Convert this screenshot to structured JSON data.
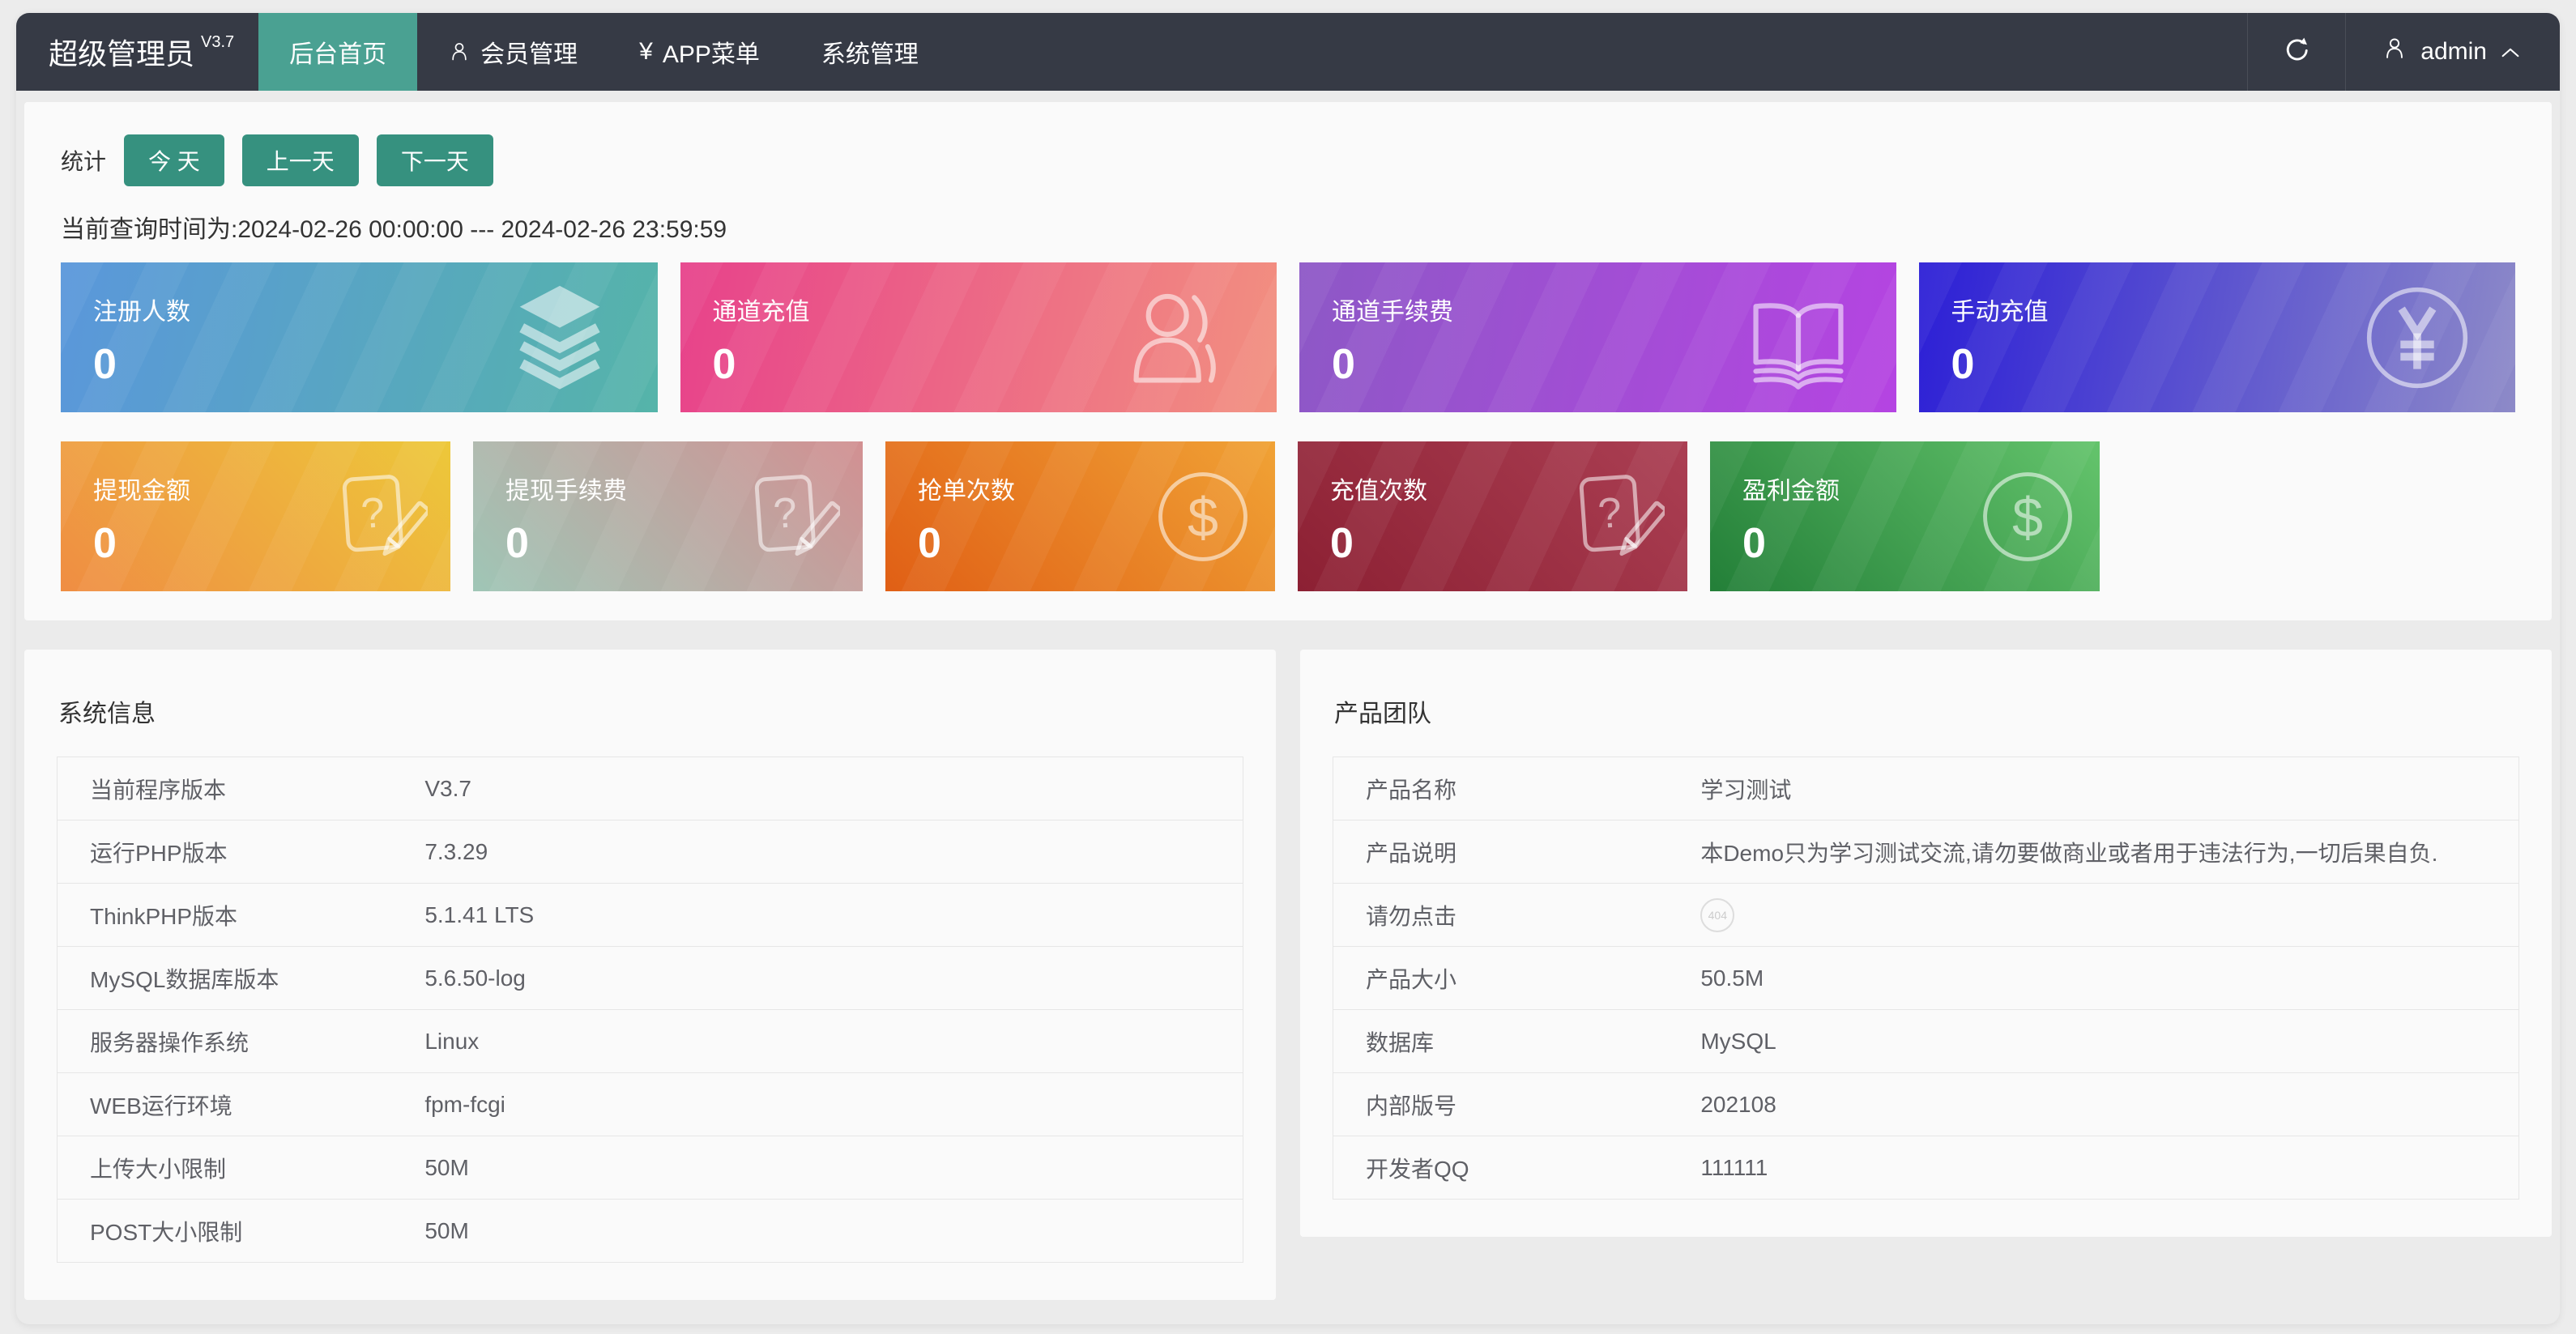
{
  "colors": {
    "navbar_bg": "#363a45",
    "tab_active": "#4aa192",
    "accent_teal": "#36917f",
    "panel_bg": "#fafafa",
    "page_bg": "#ececec"
  },
  "navbar": {
    "brand": "超级管理员",
    "brand_version": "V3.7",
    "tabs": [
      {
        "id": "home",
        "label": "后台首页",
        "active": true
      },
      {
        "id": "members",
        "label": "会员管理",
        "icon": "user-icon"
      },
      {
        "id": "app-menu",
        "label": "APP菜单",
        "icon": "yen-icon"
      },
      {
        "id": "system",
        "label": "系统管理"
      }
    ],
    "refresh_icon": "refresh-icon",
    "username": "admin"
  },
  "stats": {
    "section_label": "统计",
    "buttons": [
      {
        "id": "today",
        "label": "今 天"
      },
      {
        "id": "prev-day",
        "label": "上一天"
      },
      {
        "id": "next-day",
        "label": "下一天"
      }
    ],
    "query_time": "当前查询时间为:2024-02-26 00:00:00 --- 2024-02-26 23:59:59",
    "cards_row1": [
      {
        "id": "registered-users",
        "title": "注册人数",
        "value": "0",
        "icon": "layers-icon",
        "c1": "#5a97db",
        "c2": "#55b4a9"
      },
      {
        "id": "channel-recharge",
        "title": "通道充值",
        "value": "0",
        "icon": "user-outline-icon",
        "c1": "#e7428b",
        "c2": "#f29080"
      },
      {
        "id": "channel-fee",
        "title": "通道手续费",
        "value": "0",
        "icon": "book-icon",
        "c1": "#8d58c6",
        "c2": "#b544e2"
      },
      {
        "id": "manual-recharge",
        "title": "手动充值",
        "value": "0",
        "icon": "yen-circle-icon",
        "c1": "#2c1fd6",
        "c2": "#8d8ac8"
      }
    ],
    "cards_row2": [
      {
        "id": "withdraw-amount",
        "title": "提现金额",
        "value": "0",
        "icon": "question-doc-icon",
        "c1": "#ef8d43",
        "c2": "#edc83a"
      },
      {
        "id": "withdraw-fee",
        "title": "提现手续费",
        "value": "0",
        "icon": "question-doc-icon",
        "c1": "#9fc6b6",
        "c2": "#d29092"
      },
      {
        "id": "grab-count",
        "title": "抢单次数",
        "value": "0",
        "icon": "dollar-circle-icon",
        "c1": "#e05f15",
        "c2": "#f0a235"
      },
      {
        "id": "recharge-count",
        "title": "充值次数",
        "value": "0",
        "icon": "question-doc-icon",
        "c1": "#8c2033",
        "c2": "#ab3f53"
      },
      {
        "id": "profit-amount",
        "title": "盈利金额",
        "value": "0",
        "icon": "dollar-circle-icon",
        "c1": "#237f38",
        "c2": "#64c46c"
      }
    ]
  },
  "system_panel": {
    "title": "系统信息",
    "rows": [
      {
        "label": "当前程序版本",
        "value": "V3.7"
      },
      {
        "label": "运行PHP版本",
        "value": "7.3.29"
      },
      {
        "label": "ThinkPHP版本",
        "value": "5.1.41 LTS"
      },
      {
        "label": "MySQL数据库版本",
        "value": "5.6.50-log"
      },
      {
        "label": "服务器操作系统",
        "value": "Linux"
      },
      {
        "label": "WEB运行环境",
        "value": "fpm-fcgi"
      },
      {
        "label": "上传大小限制",
        "value": "50M"
      },
      {
        "label": "POST大小限制",
        "value": "50M"
      }
    ]
  },
  "product_panel": {
    "title": "产品团队",
    "rows": [
      {
        "label": "产品名称",
        "value": "学习测试"
      },
      {
        "label": "产品说明",
        "value": "本Demo只为学习测试交流,请勿要做商业或者用于违法行为,一切后果自负."
      },
      {
        "label": "请勿点击",
        "badge": "404"
      },
      {
        "label": "产品大小",
        "value": "50.5M"
      },
      {
        "label": "数据库",
        "value": "MySQL"
      },
      {
        "label": "内部版号",
        "value": "202108"
      },
      {
        "label": "开发者QQ",
        "value": "111111"
      }
    ]
  }
}
